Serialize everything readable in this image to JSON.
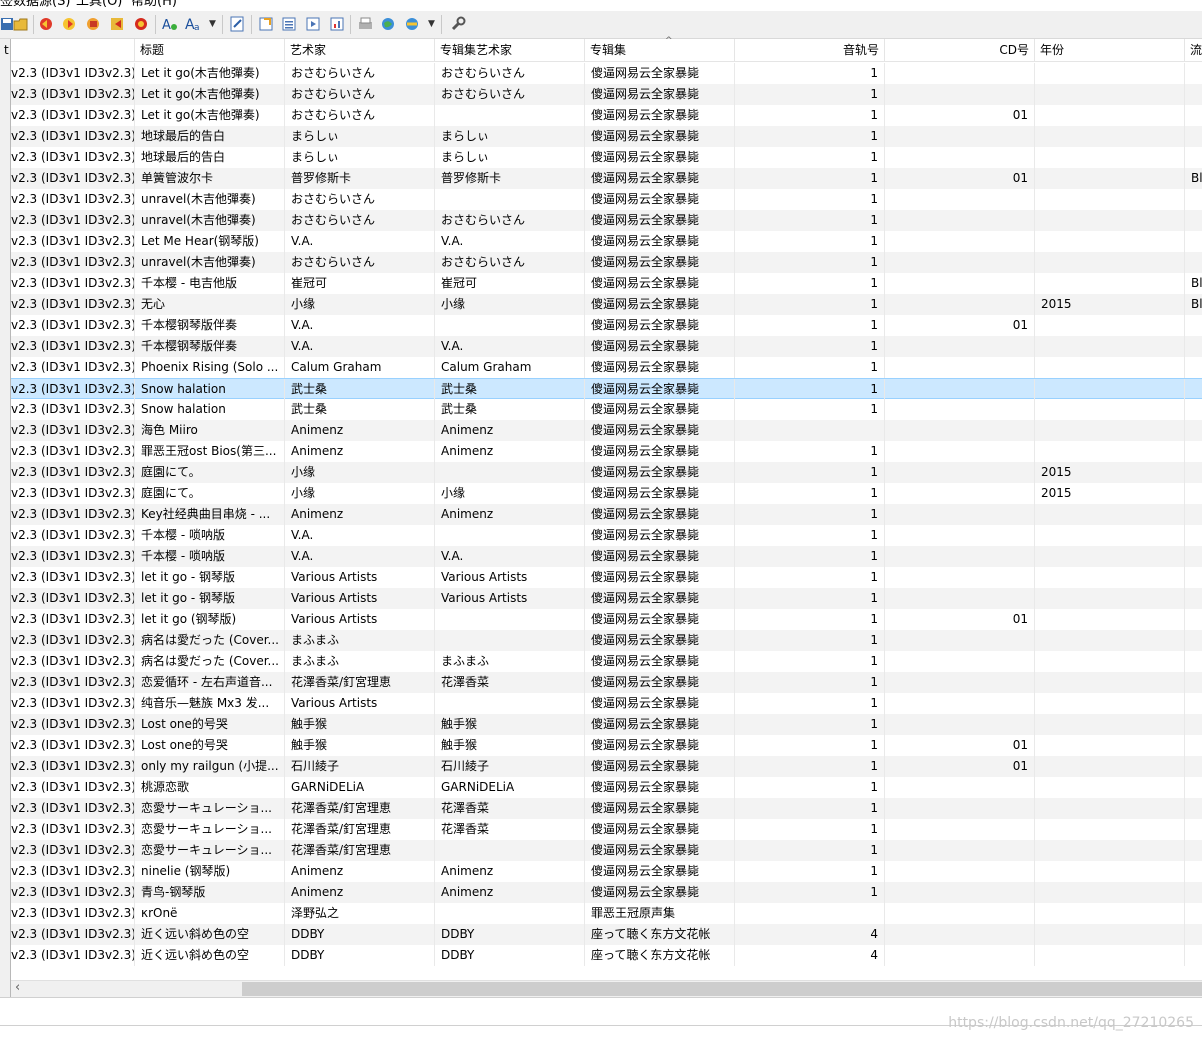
{
  "menu": [
    "签数据源(S)",
    "工具(O)",
    "帮助(H)"
  ],
  "columns": [
    "t",
    "标题",
    "艺术家",
    "专辑集艺术家",
    "专辑集",
    "音轨号",
    "CD号",
    "年份",
    "流"
  ],
  "rows": [
    {
      "tag": "v2.3 (ID3v1 ID3v2.3)",
      "title": "Let it go(木吉他彈奏)",
      "artist": "おさむらいさん",
      "album_artist": "おさむらいさん",
      "album": "傻逼网易云全家暴毙",
      "track": "1",
      "cd": "",
      "year": "",
      "genre": ""
    },
    {
      "tag": "v2.3 (ID3v1 ID3v2.3)",
      "title": "Let it go(木吉他彈奏)",
      "artist": "おさむらいさん",
      "album_artist": "おさむらいさん",
      "album": "傻逼网易云全家暴毙",
      "track": "1",
      "cd": "",
      "year": "",
      "genre": ""
    },
    {
      "tag": "v2.3 (ID3v1 ID3v2.3)",
      "title": "Let it go(木吉他彈奏)",
      "artist": "おさむらいさん",
      "album_artist": "",
      "album": "傻逼网易云全家暴毙",
      "track": "1",
      "cd": "01",
      "year": "",
      "genre": ""
    },
    {
      "tag": "v2.3 (ID3v1 ID3v2.3)",
      "title": "地球最后的告白",
      "artist": "まらしぃ",
      "album_artist": "まらしぃ",
      "album": "傻逼网易云全家暴毙",
      "track": "1",
      "cd": "",
      "year": "",
      "genre": ""
    },
    {
      "tag": "v2.3 (ID3v1 ID3v2.3)",
      "title": "地球最后的告白",
      "artist": "まらしぃ",
      "album_artist": "まらしぃ",
      "album": "傻逼网易云全家暴毙",
      "track": "1",
      "cd": "",
      "year": "",
      "genre": ""
    },
    {
      "tag": "v2.3 (ID3v1 ID3v2.3)",
      "title": "单簧管波尔卡",
      "artist": "普罗修斯卡",
      "album_artist": "普罗修斯卡",
      "album": "傻逼网易云全家暴毙",
      "track": "1",
      "cd": "01",
      "year": "",
      "genre": "Bl"
    },
    {
      "tag": "v2.3 (ID3v1 ID3v2.3)",
      "title": "unravel(木吉他彈奏)",
      "artist": "おさむらいさん",
      "album_artist": "",
      "album": "傻逼网易云全家暴毙",
      "track": "1",
      "cd": "",
      "year": "",
      "genre": ""
    },
    {
      "tag": "v2.3 (ID3v1 ID3v2.3)",
      "title": "unravel(木吉他彈奏)",
      "artist": "おさむらいさん",
      "album_artist": "おさむらいさん",
      "album": "傻逼网易云全家暴毙",
      "track": "1",
      "cd": "",
      "year": "",
      "genre": ""
    },
    {
      "tag": "v2.3 (ID3v1 ID3v2.3)",
      "title": "Let Me Hear(钢琴版)",
      "artist": "V.A.",
      "album_artist": "V.A.",
      "album": "傻逼网易云全家暴毙",
      "track": "1",
      "cd": "",
      "year": "",
      "genre": ""
    },
    {
      "tag": "v2.3 (ID3v1 ID3v2.3)",
      "title": "unravel(木吉他彈奏)",
      "artist": "おさむらいさん",
      "album_artist": "おさむらいさん",
      "album": "傻逼网易云全家暴毙",
      "track": "1",
      "cd": "",
      "year": "",
      "genre": ""
    },
    {
      "tag": "v2.3 (ID3v1 ID3v2.3)",
      "title": "千本樱 - 电吉他版",
      "artist": "崔冠可",
      "album_artist": "崔冠可",
      "album": "傻逼网易云全家暴毙",
      "track": "1",
      "cd": "",
      "year": "",
      "genre": "Bl"
    },
    {
      "tag": "v2.3 (ID3v1 ID3v2.3)",
      "title": "无心",
      "artist": "小缘",
      "album_artist": "小缘",
      "album": "傻逼网易云全家暴毙",
      "track": "1",
      "cd": "",
      "year": "2015",
      "genre": "Bl"
    },
    {
      "tag": "v2.3 (ID3v1 ID3v2.3)",
      "title": "千本樱钢琴版伴奏",
      "artist": "V.A.",
      "album_artist": "",
      "album": "傻逼网易云全家暴毙",
      "track": "1",
      "cd": "01",
      "year": "",
      "genre": ""
    },
    {
      "tag": "v2.3 (ID3v1 ID3v2.3)",
      "title": "千本樱钢琴版伴奏",
      "artist": "V.A.",
      "album_artist": "V.A.",
      "album": "傻逼网易云全家暴毙",
      "track": "1",
      "cd": "",
      "year": "",
      "genre": ""
    },
    {
      "tag": "v2.3 (ID3v1 ID3v2.3)",
      "title": "Phoenix Rising (Solo ...",
      "artist": "Calum Graham",
      "album_artist": "Calum Graham",
      "album": "傻逼网易云全家暴毙",
      "track": "1",
      "cd": "",
      "year": "",
      "genre": ""
    },
    {
      "tag": "v2.3 (ID3v1 ID3v2.3)",
      "title": "Snow halation",
      "artist": "武士桑",
      "album_artist": "武士桑",
      "album": "傻逼网易云全家暴毙",
      "track": "1",
      "cd": "",
      "year": "",
      "genre": "",
      "selected": true
    },
    {
      "tag": "v2.3 (ID3v1 ID3v2.3)",
      "title": "Snow halation",
      "artist": "武士桑",
      "album_artist": "武士桑",
      "album": "傻逼网易云全家暴毙",
      "track": "1",
      "cd": "",
      "year": "",
      "genre": ""
    },
    {
      "tag": "v2.3 (ID3v1 ID3v2.3)",
      "title": "海色 Miiro",
      "artist": "Animenz",
      "album_artist": "Animenz",
      "album": "傻逼网易云全家暴毙",
      "track": "",
      "cd": "",
      "year": "",
      "genre": ""
    },
    {
      "tag": "v2.3 (ID3v1 ID3v2.3)",
      "title": "罪恶王冠ost Bios(第三...",
      "artist": "Animenz",
      "album_artist": "Animenz",
      "album": "傻逼网易云全家暴毙",
      "track": "1",
      "cd": "",
      "year": "",
      "genre": ""
    },
    {
      "tag": "v2.3 (ID3v1 ID3v2.3)",
      "title": "庭園にて。",
      "artist": "小缘",
      "album_artist": "",
      "album": "傻逼网易云全家暴毙",
      "track": "1",
      "cd": "",
      "year": "2015",
      "genre": ""
    },
    {
      "tag": "v2.3 (ID3v1 ID3v2.3)",
      "title": "庭園にて。",
      "artist": "小缘",
      "album_artist": "小缘",
      "album": "傻逼网易云全家暴毙",
      "track": "1",
      "cd": "",
      "year": "2015",
      "genre": ""
    },
    {
      "tag": "v2.3 (ID3v1 ID3v2.3)",
      "title": "Key社经典曲目串烧 - ...",
      "artist": "Animenz",
      "album_artist": "Animenz",
      "album": "傻逼网易云全家暴毙",
      "track": "1",
      "cd": "",
      "year": "",
      "genre": ""
    },
    {
      "tag": "v2.3 (ID3v1 ID3v2.3)",
      "title": "千本樱 - 唢呐版",
      "artist": "V.A.",
      "album_artist": "",
      "album": "傻逼网易云全家暴毙",
      "track": "1",
      "cd": "",
      "year": "",
      "genre": ""
    },
    {
      "tag": "v2.3 (ID3v1 ID3v2.3)",
      "title": "千本樱 - 唢呐版",
      "artist": "V.A.",
      "album_artist": "V.A.",
      "album": "傻逼网易云全家暴毙",
      "track": "1",
      "cd": "",
      "year": "",
      "genre": ""
    },
    {
      "tag": "v2.3 (ID3v1 ID3v2.3)",
      "title": "let it go - 钢琴版",
      "artist": "Various Artists",
      "album_artist": "Various Artists",
      "album": "傻逼网易云全家暴毙",
      "track": "1",
      "cd": "",
      "year": "",
      "genre": ""
    },
    {
      "tag": "v2.3 (ID3v1 ID3v2.3)",
      "title": "let it go - 钢琴版",
      "artist": "Various Artists",
      "album_artist": "Various Artists",
      "album": "傻逼网易云全家暴毙",
      "track": "1",
      "cd": "",
      "year": "",
      "genre": ""
    },
    {
      "tag": "v2.3 (ID3v1 ID3v2.3)",
      "title": "let it go (钢琴版)",
      "artist": "Various Artists",
      "album_artist": "",
      "album": "傻逼网易云全家暴毙",
      "track": "1",
      "cd": "01",
      "year": "",
      "genre": ""
    },
    {
      "tag": "v2.3 (ID3v1 ID3v2.3)",
      "title": "病名は愛だった (Cover...",
      "artist": "まふまふ",
      "album_artist": "",
      "album": "傻逼网易云全家暴毙",
      "track": "1",
      "cd": "",
      "year": "",
      "genre": ""
    },
    {
      "tag": "v2.3 (ID3v1 ID3v2.3)",
      "title": "病名は愛だった (Cover...",
      "artist": "まふまふ",
      "album_artist": "まふまふ",
      "album": "傻逼网易云全家暴毙",
      "track": "1",
      "cd": "",
      "year": "",
      "genre": ""
    },
    {
      "tag": "v2.3 (ID3v1 ID3v2.3)",
      "title": "恋爱循环 - 左右声道音...",
      "artist": "花澤香菜/釘宮理恵",
      "album_artist": "花澤香菜",
      "album": "傻逼网易云全家暴毙",
      "track": "1",
      "cd": "",
      "year": "",
      "genre": ""
    },
    {
      "tag": "v2.3 (ID3v1 ID3v2.3)",
      "title": "纯音乐—魅族 Mx3 发...",
      "artist": "Various Artists",
      "album_artist": "",
      "album": "傻逼网易云全家暴毙",
      "track": "1",
      "cd": "",
      "year": "",
      "genre": ""
    },
    {
      "tag": "v2.3 (ID3v1 ID3v2.3)",
      "title": "Lost one的号哭",
      "artist": "触手猴",
      "album_artist": "触手猴",
      "album": "傻逼网易云全家暴毙",
      "track": "1",
      "cd": "",
      "year": "",
      "genre": ""
    },
    {
      "tag": "v2.3 (ID3v1 ID3v2.3)",
      "title": "Lost one的号哭",
      "artist": "触手猴",
      "album_artist": "触手猴",
      "album": "傻逼网易云全家暴毙",
      "track": "1",
      "cd": "01",
      "year": "",
      "genre": ""
    },
    {
      "tag": "v2.3 (ID3v1 ID3v2.3)",
      "title": "only my railgun (小提...",
      "artist": "石川綾子",
      "album_artist": "石川綾子",
      "album": "傻逼网易云全家暴毙",
      "track": "1",
      "cd": "01",
      "year": "",
      "genre": ""
    },
    {
      "tag": "v2.3 (ID3v1 ID3v2.3)",
      "title": "桃源恋歌",
      "artist": "GARNiDELiA",
      "album_artist": "GARNiDELiA",
      "album": "傻逼网易云全家暴毙",
      "track": "1",
      "cd": "",
      "year": "",
      "genre": ""
    },
    {
      "tag": "v2.3 (ID3v1 ID3v2.3)",
      "title": "恋愛サーキュレーショ...",
      "artist": "花澤香菜/釘宮理恵",
      "album_artist": "花澤香菜",
      "album": "傻逼网易云全家暴毙",
      "track": "1",
      "cd": "",
      "year": "",
      "genre": ""
    },
    {
      "tag": "v2.3 (ID3v1 ID3v2.3)",
      "title": "恋愛サーキュレーショ...",
      "artist": "花澤香菜/釘宮理恵",
      "album_artist": "花澤香菜",
      "album": "傻逼网易云全家暴毙",
      "track": "1",
      "cd": "",
      "year": "",
      "genre": ""
    },
    {
      "tag": "v2.3 (ID3v1 ID3v2.3)",
      "title": "恋愛サーキュレーショ...",
      "artist": "花澤香菜/釘宮理恵",
      "album_artist": "",
      "album": "傻逼网易云全家暴毙",
      "track": "1",
      "cd": "",
      "year": "",
      "genre": ""
    },
    {
      "tag": "v2.3 (ID3v1 ID3v2.3)",
      "title": "ninelie (钢琴版)",
      "artist": "Animenz",
      "album_artist": "Animenz",
      "album": "傻逼网易云全家暴毙",
      "track": "1",
      "cd": "",
      "year": "",
      "genre": ""
    },
    {
      "tag": "v2.3 (ID3v1 ID3v2.3)",
      "title": "青鸟-钢琴版",
      "artist": "Animenz",
      "album_artist": "Animenz",
      "album": "傻逼网易云全家暴毙",
      "track": "1",
      "cd": "",
      "year": "",
      "genre": ""
    },
    {
      "tag": "v2.3 (ID3v1 ID3v2.3)",
      "title": "κrOnë",
      "artist": "泽野弘之",
      "album_artist": "",
      "album": "罪恶王冠原声集",
      "track": "",
      "cd": "",
      "year": "",
      "genre": ""
    },
    {
      "tag": "v2.3 (ID3v1 ID3v2.3)",
      "title": "近く远い斜め色の空",
      "artist": "DDBY",
      "album_artist": "DDBY",
      "album": "座って聴く东方文花帐",
      "track": "4",
      "cd": "",
      "year": "",
      "genre": ""
    },
    {
      "tag": "v2.3 (ID3v1 ID3v2.3)",
      "title": "近く远い斜め色の空",
      "artist": "DDBY",
      "album_artist": "DDBY",
      "album": "座って聴く东方文花帐",
      "track": "4",
      "cd": "",
      "year": "",
      "genre": ""
    }
  ],
  "watermark": "https://blog.csdn.net/qq_27210265",
  "colors": {
    "selected_row": "#cce8ff",
    "alt_row": "#f3f3f3"
  }
}
